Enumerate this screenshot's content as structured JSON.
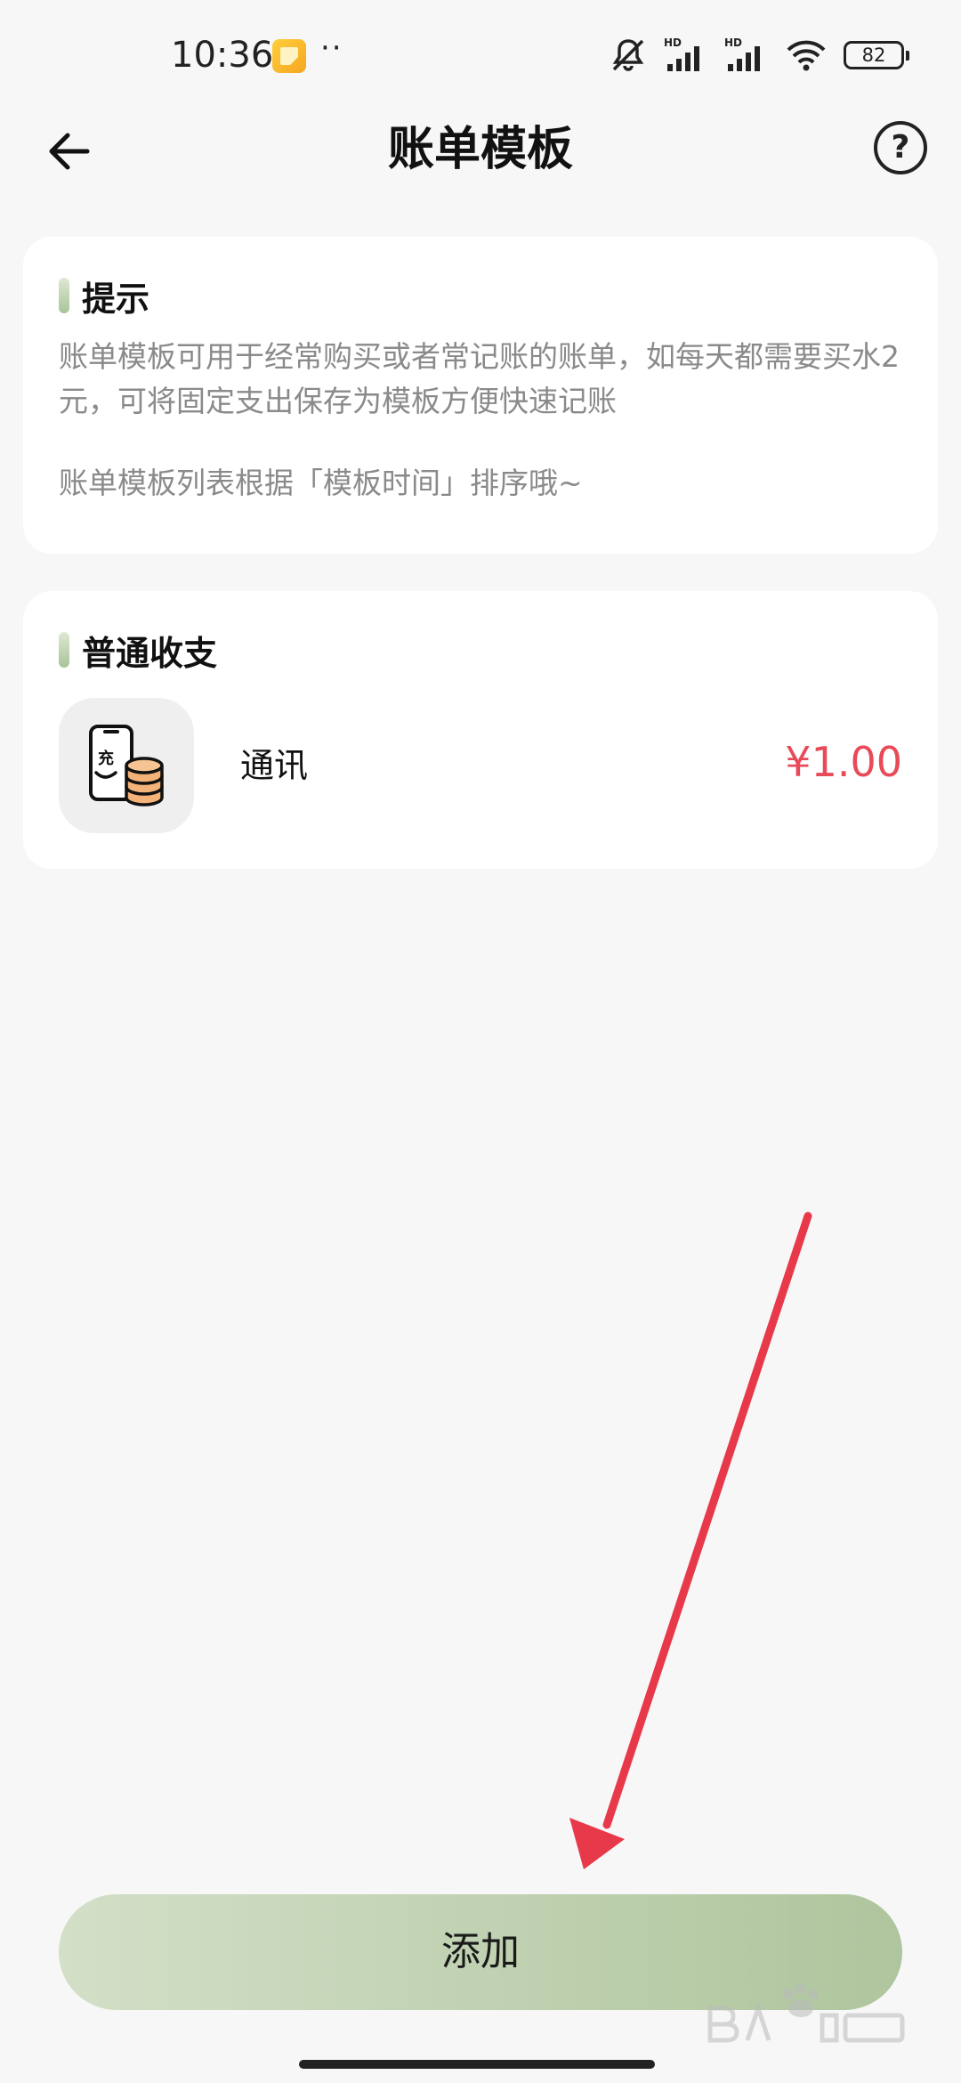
{
  "status_bar": {
    "time": "10:36",
    "dots": "··",
    "battery": "82"
  },
  "header": {
    "title": "账单模板",
    "help_label": "?"
  },
  "tip_card": {
    "title": "提示",
    "text": "账单模板可用于经常购买或者常记账的账单，如每天都需要买水2元，可将固定支出保存为模板方便快速记账",
    "text2": "账单模板列表根据「模板时间」排序哦~"
  },
  "bills_card": {
    "title": "普通收支",
    "items": [
      {
        "name": "通讯",
        "amount": "¥1.00",
        "icon_label": "充",
        "icon": "phone-recharge-icon"
      }
    ]
  },
  "add_button": {
    "label": "添加"
  },
  "colors": {
    "accent_green": "#aec59d",
    "amount_red": "#e84a58",
    "annotation_red": "#e8394a"
  }
}
